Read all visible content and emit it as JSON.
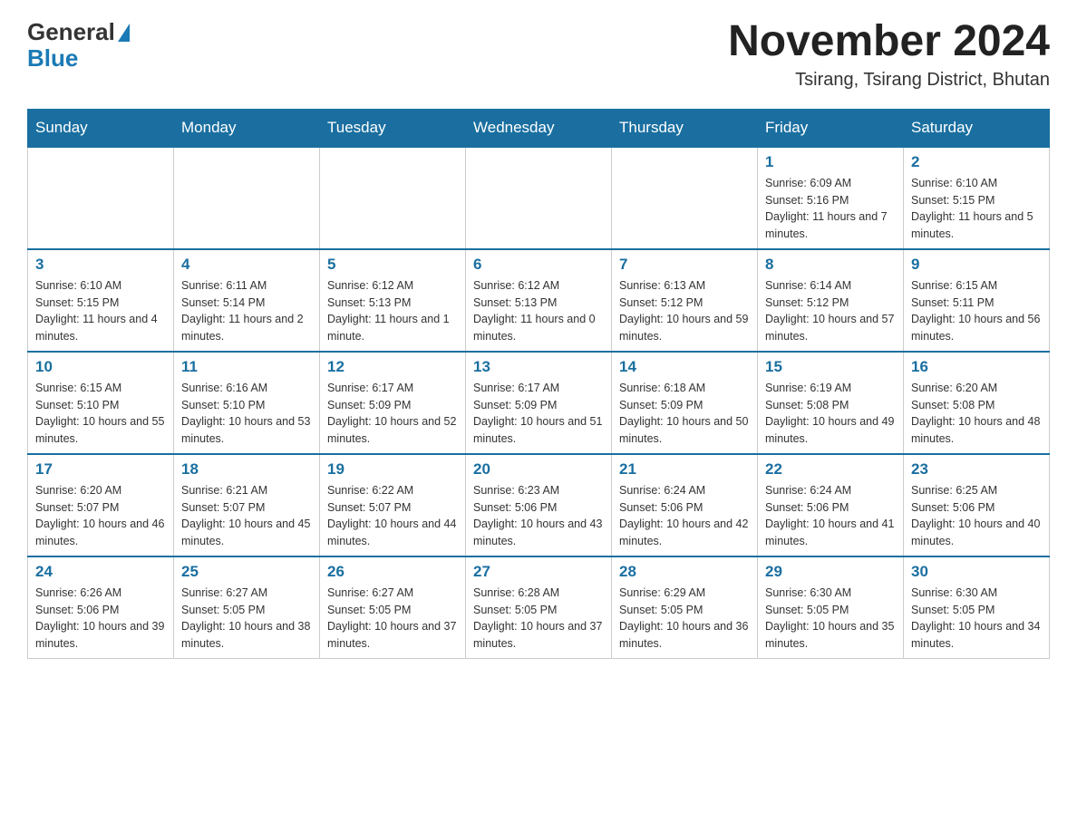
{
  "header": {
    "logo_line1": "General",
    "logo_line2": "Blue",
    "month_title": "November 2024",
    "location": "Tsirang, Tsirang District, Bhutan"
  },
  "days_of_week": [
    "Sunday",
    "Monday",
    "Tuesday",
    "Wednesday",
    "Thursday",
    "Friday",
    "Saturday"
  ],
  "weeks": [
    [
      {
        "day": "",
        "info": ""
      },
      {
        "day": "",
        "info": ""
      },
      {
        "day": "",
        "info": ""
      },
      {
        "day": "",
        "info": ""
      },
      {
        "day": "",
        "info": ""
      },
      {
        "day": "1",
        "info": "Sunrise: 6:09 AM\nSunset: 5:16 PM\nDaylight: 11 hours and 7 minutes."
      },
      {
        "day": "2",
        "info": "Sunrise: 6:10 AM\nSunset: 5:15 PM\nDaylight: 11 hours and 5 minutes."
      }
    ],
    [
      {
        "day": "3",
        "info": "Sunrise: 6:10 AM\nSunset: 5:15 PM\nDaylight: 11 hours and 4 minutes."
      },
      {
        "day": "4",
        "info": "Sunrise: 6:11 AM\nSunset: 5:14 PM\nDaylight: 11 hours and 2 minutes."
      },
      {
        "day": "5",
        "info": "Sunrise: 6:12 AM\nSunset: 5:13 PM\nDaylight: 11 hours and 1 minute."
      },
      {
        "day": "6",
        "info": "Sunrise: 6:12 AM\nSunset: 5:13 PM\nDaylight: 11 hours and 0 minutes."
      },
      {
        "day": "7",
        "info": "Sunrise: 6:13 AM\nSunset: 5:12 PM\nDaylight: 10 hours and 59 minutes."
      },
      {
        "day": "8",
        "info": "Sunrise: 6:14 AM\nSunset: 5:12 PM\nDaylight: 10 hours and 57 minutes."
      },
      {
        "day": "9",
        "info": "Sunrise: 6:15 AM\nSunset: 5:11 PM\nDaylight: 10 hours and 56 minutes."
      }
    ],
    [
      {
        "day": "10",
        "info": "Sunrise: 6:15 AM\nSunset: 5:10 PM\nDaylight: 10 hours and 55 minutes."
      },
      {
        "day": "11",
        "info": "Sunrise: 6:16 AM\nSunset: 5:10 PM\nDaylight: 10 hours and 53 minutes."
      },
      {
        "day": "12",
        "info": "Sunrise: 6:17 AM\nSunset: 5:09 PM\nDaylight: 10 hours and 52 minutes."
      },
      {
        "day": "13",
        "info": "Sunrise: 6:17 AM\nSunset: 5:09 PM\nDaylight: 10 hours and 51 minutes."
      },
      {
        "day": "14",
        "info": "Sunrise: 6:18 AM\nSunset: 5:09 PM\nDaylight: 10 hours and 50 minutes."
      },
      {
        "day": "15",
        "info": "Sunrise: 6:19 AM\nSunset: 5:08 PM\nDaylight: 10 hours and 49 minutes."
      },
      {
        "day": "16",
        "info": "Sunrise: 6:20 AM\nSunset: 5:08 PM\nDaylight: 10 hours and 48 minutes."
      }
    ],
    [
      {
        "day": "17",
        "info": "Sunrise: 6:20 AM\nSunset: 5:07 PM\nDaylight: 10 hours and 46 minutes."
      },
      {
        "day": "18",
        "info": "Sunrise: 6:21 AM\nSunset: 5:07 PM\nDaylight: 10 hours and 45 minutes."
      },
      {
        "day": "19",
        "info": "Sunrise: 6:22 AM\nSunset: 5:07 PM\nDaylight: 10 hours and 44 minutes."
      },
      {
        "day": "20",
        "info": "Sunrise: 6:23 AM\nSunset: 5:06 PM\nDaylight: 10 hours and 43 minutes."
      },
      {
        "day": "21",
        "info": "Sunrise: 6:24 AM\nSunset: 5:06 PM\nDaylight: 10 hours and 42 minutes."
      },
      {
        "day": "22",
        "info": "Sunrise: 6:24 AM\nSunset: 5:06 PM\nDaylight: 10 hours and 41 minutes."
      },
      {
        "day": "23",
        "info": "Sunrise: 6:25 AM\nSunset: 5:06 PM\nDaylight: 10 hours and 40 minutes."
      }
    ],
    [
      {
        "day": "24",
        "info": "Sunrise: 6:26 AM\nSunset: 5:06 PM\nDaylight: 10 hours and 39 minutes."
      },
      {
        "day": "25",
        "info": "Sunrise: 6:27 AM\nSunset: 5:05 PM\nDaylight: 10 hours and 38 minutes."
      },
      {
        "day": "26",
        "info": "Sunrise: 6:27 AM\nSunset: 5:05 PM\nDaylight: 10 hours and 37 minutes."
      },
      {
        "day": "27",
        "info": "Sunrise: 6:28 AM\nSunset: 5:05 PM\nDaylight: 10 hours and 37 minutes."
      },
      {
        "day": "28",
        "info": "Sunrise: 6:29 AM\nSunset: 5:05 PM\nDaylight: 10 hours and 36 minutes."
      },
      {
        "day": "29",
        "info": "Sunrise: 6:30 AM\nSunset: 5:05 PM\nDaylight: 10 hours and 35 minutes."
      },
      {
        "day": "30",
        "info": "Sunrise: 6:30 AM\nSunset: 5:05 PM\nDaylight: 10 hours and 34 minutes."
      }
    ]
  ]
}
